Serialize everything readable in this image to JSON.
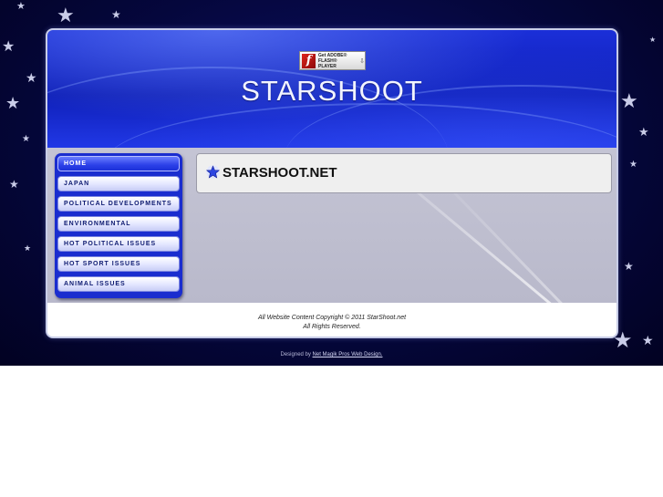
{
  "header": {
    "title": "STARSHOOT",
    "flash_badge": {
      "line1": "Get ADOBE®",
      "line2": "FLASH® PLAYER",
      "logo_glyph": "f"
    }
  },
  "nav": {
    "items": [
      {
        "label": "HOME",
        "active": true
      },
      {
        "label": "JAPAN",
        "active": false
      },
      {
        "label": "POLITICAL DEVELOPMENTS",
        "active": false
      },
      {
        "label": "ENVIRONMENTAL",
        "active": false
      },
      {
        "label": "HOT POLITICAL ISSUES",
        "active": false
      },
      {
        "label": "HOT SPORT ISSUES",
        "active": false
      },
      {
        "label": "ANIMAL ISSUES",
        "active": false
      }
    ]
  },
  "content": {
    "heading": "STARSHOOT.NET",
    "heading_icon": "star-icon"
  },
  "footer": {
    "copyright_line1": "All Website Content Copyright © 2011 StarShoot.net",
    "copyright_line2": "All Rights Reserved.",
    "designed_by_prefix": "Designed by",
    "designed_by_link": "Net Magik Pros Web Design."
  },
  "colors": {
    "background_dark": "#05073d",
    "header_blue": "#1b2fd8",
    "nav_blue": "#1a2dcf",
    "content_gray": "#c4c4d4"
  }
}
